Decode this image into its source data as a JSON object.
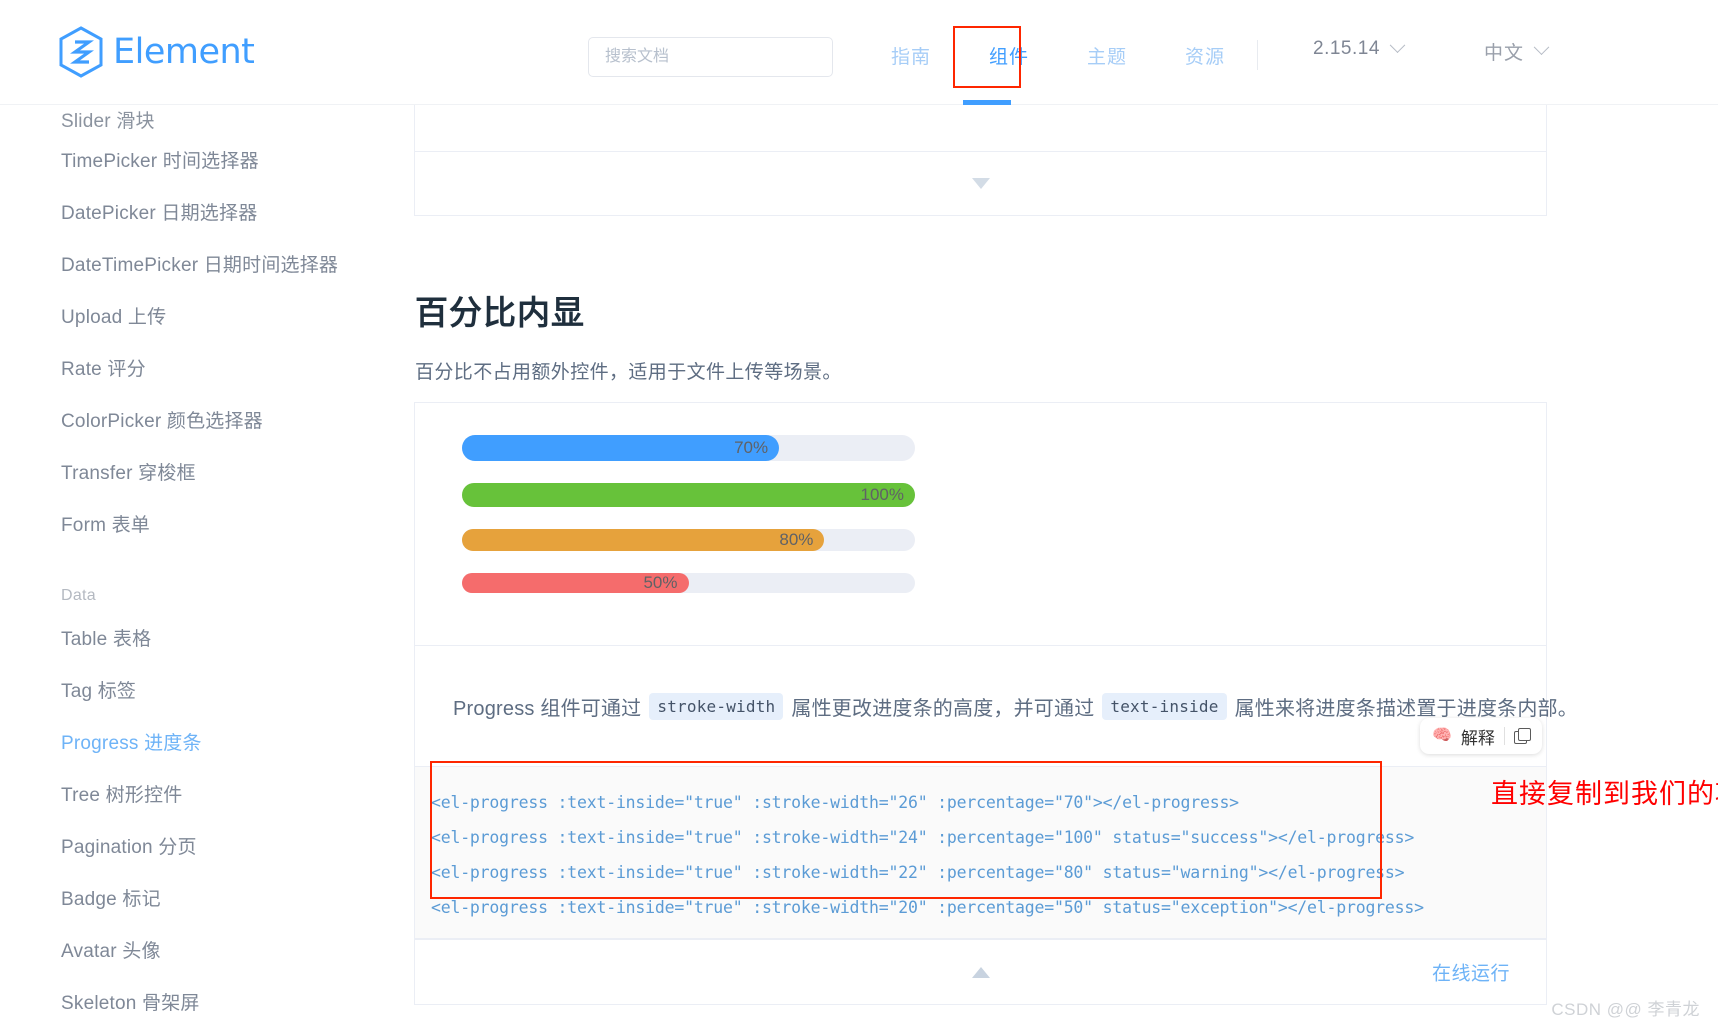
{
  "header": {
    "brand": "Element",
    "search": {
      "placeholder": "搜索文档",
      "value": ""
    },
    "nav": [
      {
        "label": "指南",
        "active": false
      },
      {
        "label": "组件",
        "active": true
      },
      {
        "label": "主题",
        "active": false
      },
      {
        "label": "资源",
        "active": false
      }
    ],
    "version": "2.15.14",
    "language": "中文"
  },
  "sidebar": {
    "items": [
      {
        "label": "Slider 滑块",
        "active": false,
        "clipped": true
      },
      {
        "label": "TimePicker 时间选择器",
        "active": false
      },
      {
        "label": "DatePicker 日期选择器",
        "active": false
      },
      {
        "label": "DateTimePicker 日期时间选择器",
        "active": false
      },
      {
        "label": "Upload 上传",
        "active": false
      },
      {
        "label": "Rate 评分",
        "active": false
      },
      {
        "label": "ColorPicker 颜色选择器",
        "active": false
      },
      {
        "label": "Transfer 穿梭框",
        "active": false
      },
      {
        "label": "Form 表单",
        "active": false
      }
    ],
    "group_label": "Data",
    "data_items": [
      {
        "label": "Table 表格",
        "active": false
      },
      {
        "label": "Tag 标签",
        "active": false
      },
      {
        "label": "Progress 进度条",
        "active": true
      },
      {
        "label": "Tree 树形控件",
        "active": false
      },
      {
        "label": "Pagination 分页",
        "active": false
      },
      {
        "label": "Badge 标记",
        "active": false
      },
      {
        "label": "Avatar 头像",
        "active": false
      },
      {
        "label": "Skeleton 骨架屏",
        "active": false
      }
    ]
  },
  "main": {
    "section_title": "百分比内显",
    "section_desc": "百分比不占用额外控件，适用于文件上传等场景。",
    "progress_bars": [
      {
        "percentage": 70,
        "label": "70%",
        "color": "#409eff",
        "stroke_width": 26
      },
      {
        "percentage": 100,
        "label": "100%",
        "color": "#67c23a",
        "stroke_width": 24
      },
      {
        "percentage": 80,
        "label": "80%",
        "color": "#e6a23c",
        "stroke_width": 22
      },
      {
        "percentage": 50,
        "label": "50%",
        "color": "#f56c6c",
        "stroke_width": 20
      }
    ],
    "note": {
      "part1": "Progress 组件可通过",
      "code1": "stroke-width",
      "part2": "属性更改进度条的高度，并可通过",
      "code2": "text-inside",
      "part3": "属性来将进度条描述置于进度条内部。"
    },
    "code_lines": [
      "<el-progress :text-inside=\"true\" :stroke-width=\"26\" :percentage=\"70\"></el-progress>",
      "<el-progress :text-inside=\"true\" :stroke-width=\"24\" :percentage=\"100\" status=\"success\"></el-progress>",
      "<el-progress :text-inside=\"true\" :stroke-width=\"22\" :percentage=\"80\" status=\"warning\"></el-progress>",
      "<el-progress :text-inside=\"true\" :stroke-width=\"20\" :percentage=\"50\" status=\"exception\"></el-progress>"
    ],
    "explain_button": {
      "label": "解释",
      "icon": "🧠"
    },
    "annotation": "直接复制到我们的项目中",
    "run_link": "在线运行"
  },
  "watermark": "CSDN @@ 李青龙"
}
